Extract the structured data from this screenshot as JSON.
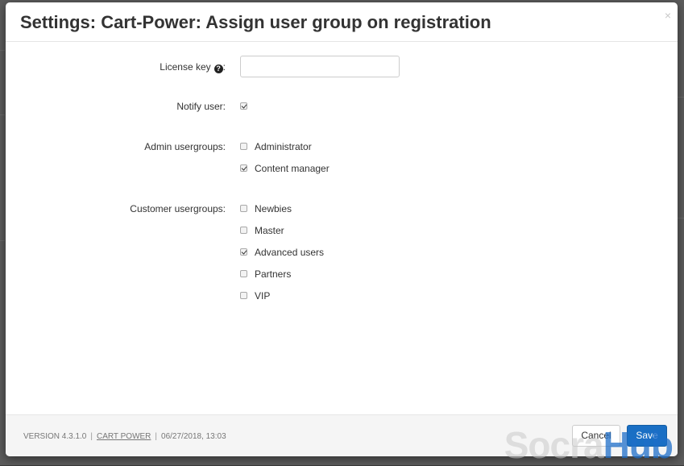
{
  "dialog": {
    "title": "Settings: Cart-Power: Assign user group on registration",
    "close_icon": "×"
  },
  "form": {
    "license_key": {
      "label": "License key",
      "help_icon": "question-circle-icon",
      "suffix": ":",
      "value": "",
      "placeholder": ""
    },
    "notify_user": {
      "label": "Notify user:",
      "checked": true
    },
    "admin_usergroups": {
      "label": "Admin usergroups:",
      "options": [
        {
          "label": "Administrator",
          "checked": false
        },
        {
          "label": "Content manager",
          "checked": true
        }
      ]
    },
    "customer_usergroups": {
      "label": "Customer usergroups:",
      "options": [
        {
          "label": "Newbies",
          "checked": false
        },
        {
          "label": "Master",
          "checked": false
        },
        {
          "label": "Advanced users",
          "checked": true
        },
        {
          "label": "Partners",
          "checked": false
        },
        {
          "label": "VIP",
          "checked": false
        }
      ]
    }
  },
  "footer": {
    "version": "VERSION 4.3.1.0",
    "vendor_link": "CART POWER",
    "date": "06/27/2018, 13:03",
    "cancel_label": "Cancel",
    "save_label": "Save"
  },
  "watermark": {
    "part1": "Socra",
    "part2": "Hub"
  },
  "colors": {
    "primary": "#1a6fc4",
    "overlay": "#3a3a3a"
  }
}
